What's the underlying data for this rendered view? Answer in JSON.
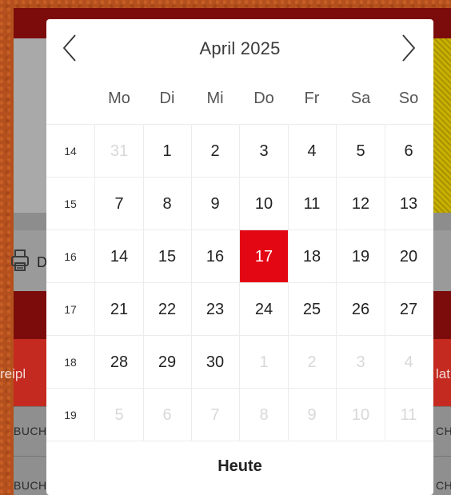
{
  "background": {
    "left_tab_text": "reipl",
    "right_tab_text": "lat",
    "left_toolbar_letter": "D",
    "row_left_text": "BUCH",
    "row_right_text": "CHE"
  },
  "datepicker": {
    "month_title": "April 2025",
    "prev_icon": "chevron-left-icon",
    "next_icon": "chevron-right-icon",
    "weekdays": [
      "Mo",
      "Di",
      "Mi",
      "Do",
      "Fr",
      "Sa",
      "So"
    ],
    "weeks": [
      {
        "week": "14",
        "days": [
          "31",
          "1",
          "2",
          "3",
          "4",
          "5",
          "6"
        ]
      },
      {
        "week": "15",
        "days": [
          "7",
          "8",
          "9",
          "10",
          "11",
          "12",
          "13"
        ]
      },
      {
        "week": "16",
        "days": [
          "14",
          "15",
          "16",
          "17",
          "18",
          "19",
          "20"
        ]
      },
      {
        "week": "17",
        "days": [
          "21",
          "22",
          "23",
          "24",
          "25",
          "26",
          "27"
        ]
      },
      {
        "week": "18",
        "days": [
          "28",
          "29",
          "30",
          "1",
          "2",
          "3",
          "4"
        ]
      },
      {
        "week": "19",
        "days": [
          "5",
          "6",
          "7",
          "8",
          "9",
          "10",
          "11"
        ]
      }
    ],
    "selected_day": "17",
    "today_label": "Heute",
    "selected_color": "#e30613"
  }
}
